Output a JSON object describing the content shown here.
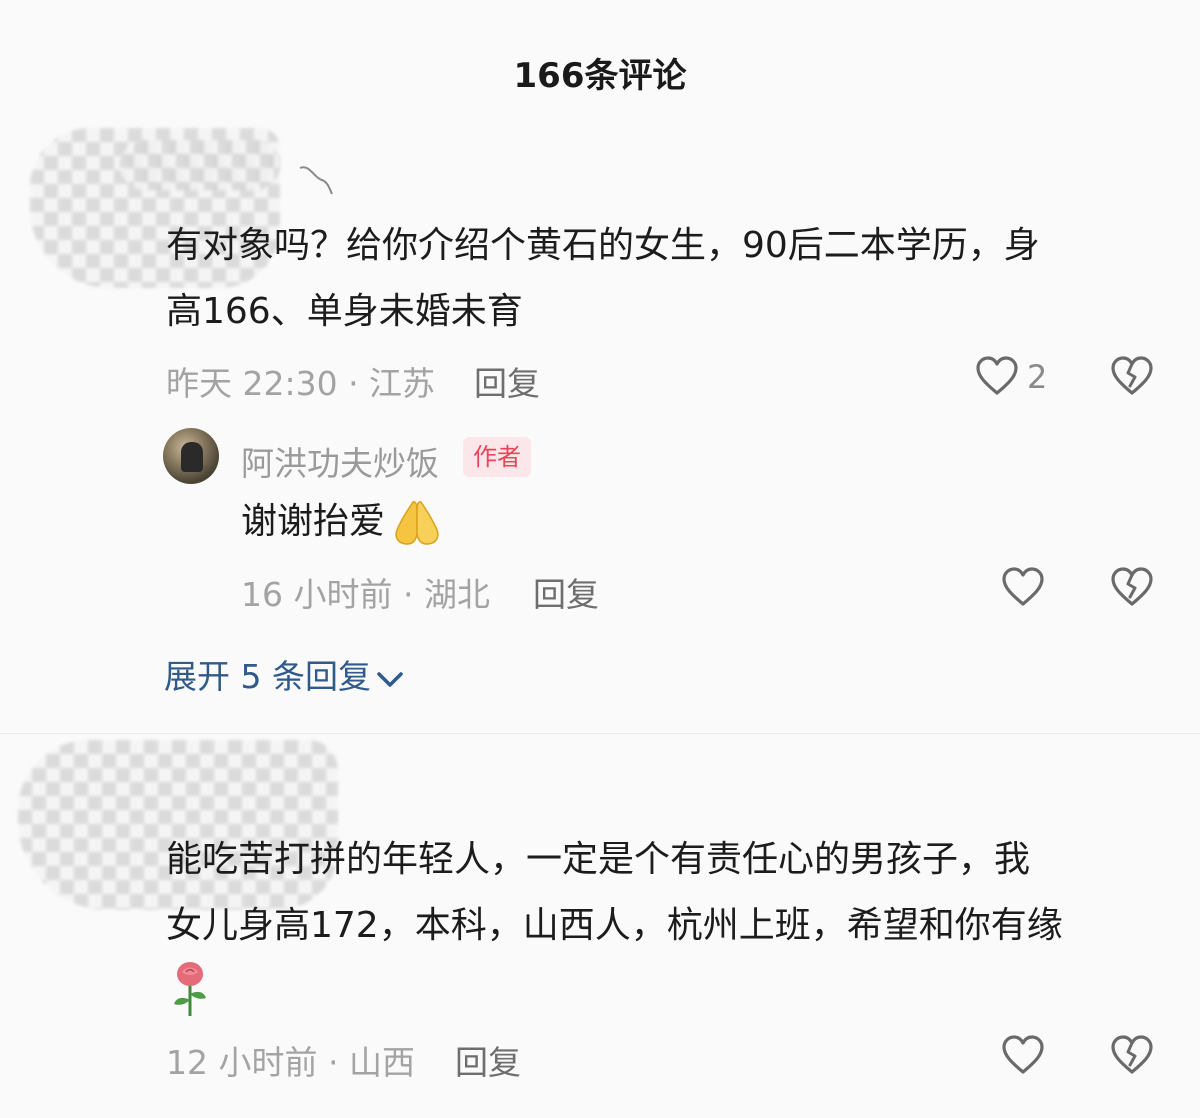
{
  "header": {
    "title": "166条评论"
  },
  "comments": [
    {
      "text_line1": "有对象吗？给你介绍个黄石的女生，90后二本学历，身",
      "text_line2": "高166、单身未婚未育",
      "meta": "昨天 22:30 · 江苏",
      "reply_label": "回复",
      "like_count": "2",
      "replies": [
        {
          "author": "阿洪功夫炒饭",
          "badge": "作者",
          "text": "谢谢抬爱",
          "meta": "16 小时前 · 湖北",
          "reply_label": "回复"
        }
      ],
      "expand_label": "展开 5 条回复"
    },
    {
      "text_line1": "能吃苦打拼的年轻人，一定是个有责任心的男孩子，我",
      "text_line2": "女儿身高172，本科，山西人，杭州上班，希望和你有缘",
      "meta": "12 小时前 · 山西",
      "reply_label": "回复"
    }
  ],
  "icons": {
    "like": "heart-outline-icon",
    "dislike": "broken-heart-icon",
    "expand": "chevron-down-icon",
    "reply_emoji": "pray-hands-emoji",
    "comment_emoji": "rose-emoji"
  },
  "colors": {
    "link": "#2f5a8a",
    "badge_text": "#e8445a",
    "badge_bg": "#fbe7ea",
    "meta": "#a3a3a3"
  }
}
